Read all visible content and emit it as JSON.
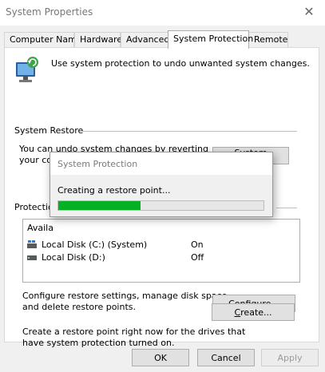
{
  "window": {
    "title": "System Properties",
    "close_glyph": "✕"
  },
  "tabs": [
    {
      "label": "Computer Name",
      "active": false
    },
    {
      "label": "Hardware",
      "active": false
    },
    {
      "label": "Advanced",
      "active": false
    },
    {
      "label": "System Protection",
      "active": true
    },
    {
      "label": "Remote",
      "active": false
    }
  ],
  "panel": {
    "intro": "Use system protection to undo unwanted system changes.",
    "restore": {
      "section_label": "System Restore",
      "description_line1": "You can undo system changes by reverting",
      "description_line2": "your computer to a previous restore point.",
      "button_prefix": "S",
      "button_rest": "ystem Restore..."
    },
    "protection": {
      "section_label": "Protection Settings",
      "section_label_visible": "Protectio",
      "list_header": "Available Drives",
      "list_header_visible": "Availa",
      "drives": [
        {
          "name": "Local Disk (C:) (System)",
          "status": "On",
          "icon": "system-drive-icon"
        },
        {
          "name": "Local Disk (D:)",
          "status": "Off",
          "icon": "drive-icon"
        }
      ]
    },
    "configure": {
      "description_line1": "Configure restore settings, manage disk space,",
      "description_line2": "and delete restore points.",
      "button_prefix": "",
      "button_underline": "C",
      "button_rest": "onfigure..."
    },
    "create": {
      "description_line1": "Create a restore point right now for the drives that",
      "description_line2": "have system protection turned on.",
      "button_prefix": "",
      "button_underline": "C",
      "button_rest": "reate..."
    }
  },
  "footer": {
    "ok_label": "OK",
    "cancel_label": "Cancel",
    "apply_label": "Apply"
  },
  "dialog": {
    "title": "System Protection",
    "message": "Creating a restore point...",
    "progress": 0.4
  },
  "colors": {
    "progress_fill": "#06b025",
    "window_bg": "#f0f0f0",
    "button_bg": "#e1e1e1"
  }
}
